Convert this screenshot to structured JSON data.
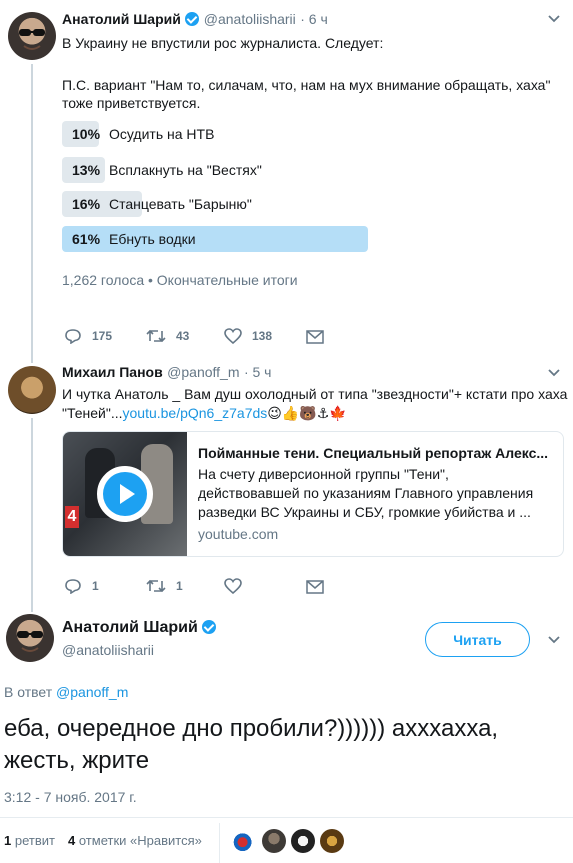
{
  "tweet1": {
    "author_name": "Анатолий Шарий",
    "handle": "@anatoliisharii",
    "time": "· 6 ч",
    "line1": "В Украину не впустили рос журналиста. Следует:",
    "line2": "П.С. вариант \"Нам то, силачам, что, нам на мух внимание обращать, хаха\"",
    "line3": "тоже приветствуется.",
    "poll": [
      {
        "pct": "10%",
        "label": "Осудить на НТВ",
        "value": 10
      },
      {
        "pct": "13%",
        "label": "Всплакнуть на \"Вестях\"",
        "value": 13
      },
      {
        "pct": "16%",
        "label": "Станцевать \"Барыню\"",
        "value": 16
      },
      {
        "pct": "61%",
        "label": "Ебнуть водки",
        "value": 61
      }
    ],
    "poll_meta": "1,262 голоса • Окончательные итоги",
    "replies": "175",
    "retweets": "43",
    "likes": "138"
  },
  "tweet2": {
    "author_name": "Михаил Панов",
    "handle": "@panoff_m",
    "time": "· 5 ч",
    "text_a": "И чутка Анатоль _ Вам душ охолодный от типа \"звездности\"+ кстати про хаха",
    "text_b": "\"Теней\"...",
    "link": "youtu.be/pQn6_z7a7ds",
    "emoji": "😉👍🐻⚓🍁",
    "card_title": "Пойманные тени. Специальный репортаж Алекс...",
    "card_desc1": "На счету диверсионной группы \"Тени\",",
    "card_desc2": "действовавшей по указаниям Главного управления",
    "card_desc3": "разведки ВС Украины и СБУ, громкие убийства и ...",
    "card_domain": "youtube.com",
    "card_channel": "4",
    "replies": "1",
    "retweets": "1"
  },
  "tweet3": {
    "author_name": "Анатолий Шарий",
    "handle": "@anatoliisharii",
    "follow_label": "Читать",
    "reply_prefix": "В ответ",
    "reply_to": "@panoff_m",
    "text1": "еба, очередное дно пробили?)))))) ахххахха,",
    "text2": "жесть, жрите",
    "timestamp": "3:12 - 7 нояб. 2017 г.",
    "retweet_count": "1",
    "retweet_label": "ретвит",
    "like_count": "4",
    "like_label": "отметки «Нравится»"
  },
  "colors": {
    "accent": "#1da1f2",
    "link": "#1b95e0",
    "muted": "#657786",
    "poll_bar": "#e1e8ed",
    "poll_winner": "#b5def7"
  },
  "icons": [
    "reply-icon",
    "retweet-icon",
    "like-icon",
    "dm-icon",
    "verified-icon",
    "chevron-down-icon",
    "play-icon"
  ]
}
